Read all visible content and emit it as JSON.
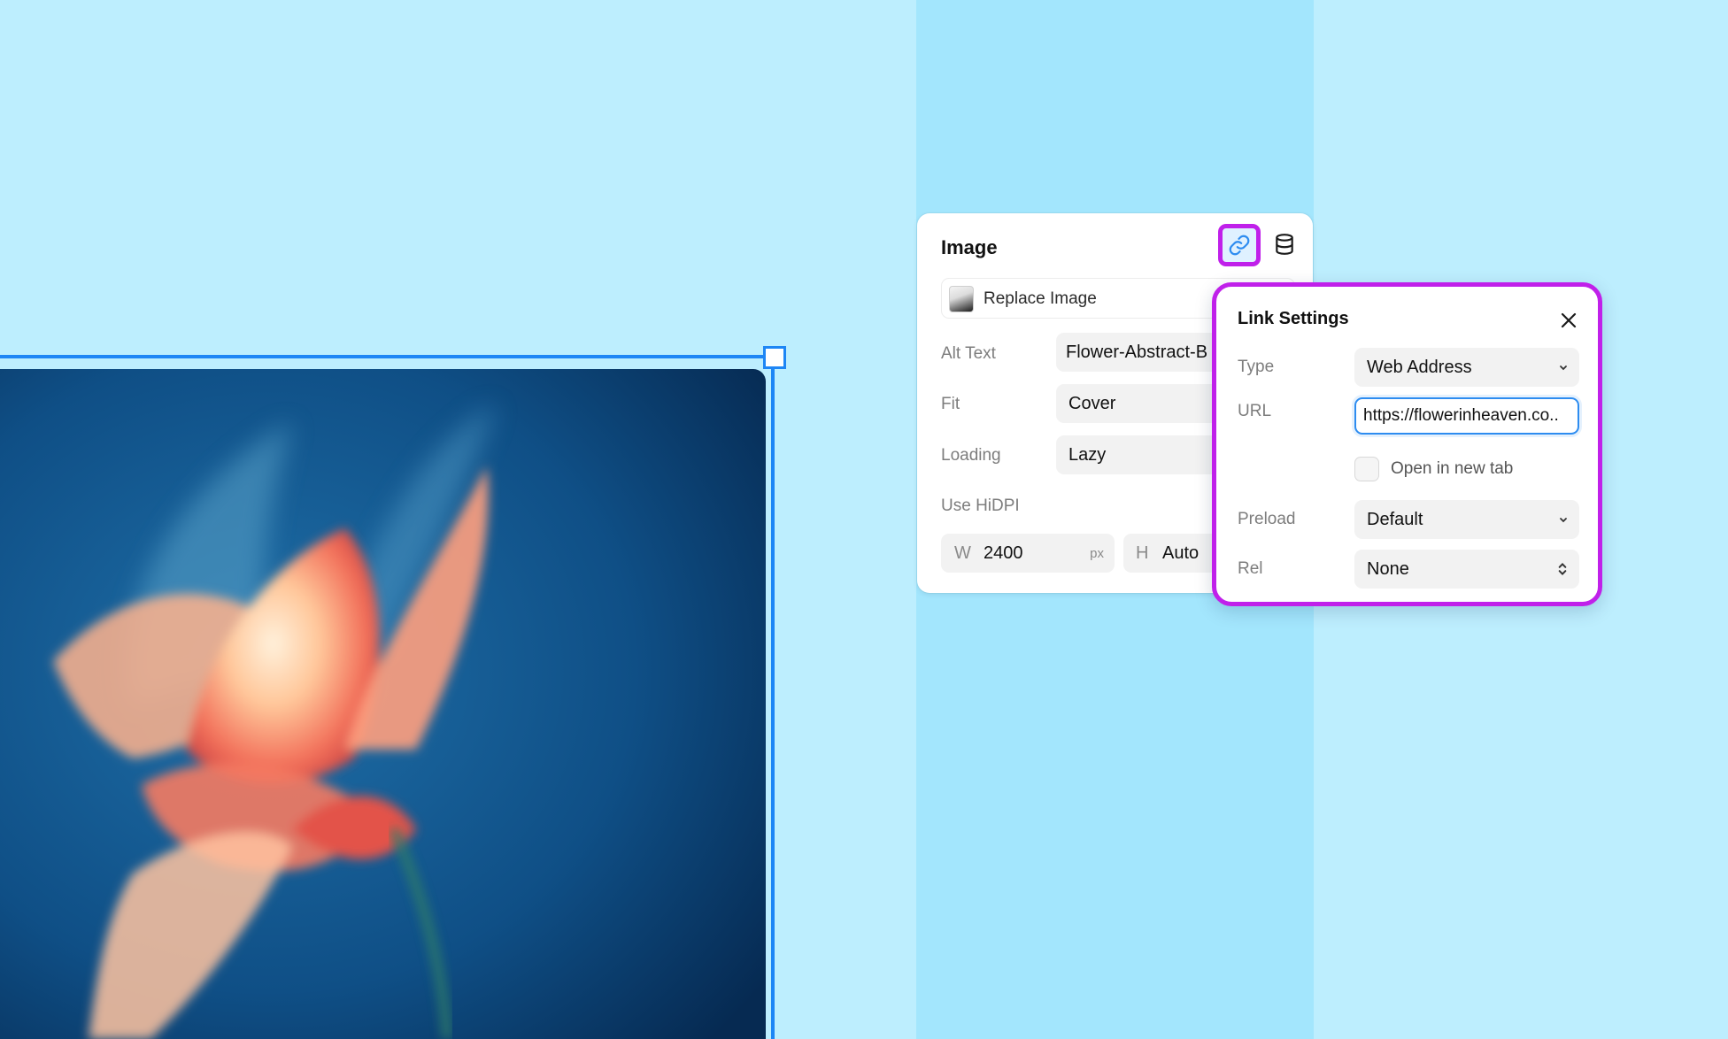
{
  "canvas": {
    "image_alt": "Flower-Abstract-B"
  },
  "panel": {
    "title": "Image",
    "link_icon": "link-icon",
    "data_icon": "database-icon",
    "replace_label": "Replace Image",
    "rows": {
      "alt_text": {
        "label": "Alt Text",
        "value": "Flower-Abstract-B"
      },
      "fit": {
        "label": "Fit",
        "value": "Cover"
      },
      "loading": {
        "label": "Loading",
        "value": "Lazy"
      },
      "hidpi": {
        "label": "Use HiDPI"
      }
    },
    "width": {
      "key": "W",
      "value": "2400",
      "unit": "px"
    },
    "height": {
      "key": "H",
      "value": "Auto"
    }
  },
  "link_settings": {
    "title": "Link Settings",
    "close_icon": "close-icon",
    "type": {
      "label": "Type",
      "value": "Web Address"
    },
    "url": {
      "label": "URL",
      "value": "https://flowerinheaven.co.."
    },
    "open_new_tab": {
      "label": "Open in new tab",
      "checked": false
    },
    "preload": {
      "label": "Preload",
      "value": "Default"
    },
    "rel": {
      "label": "Rel",
      "value": "None"
    }
  },
  "colors": {
    "background": "#bdeefe",
    "column": "#a3e6fd",
    "selection": "#1e86f5",
    "highlight": "#c020ea"
  }
}
